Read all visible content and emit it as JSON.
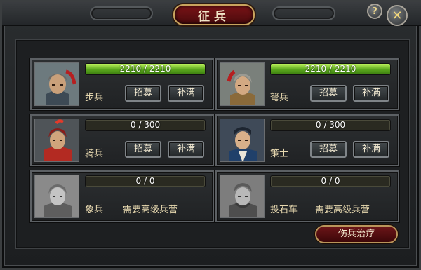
{
  "window": {
    "title": "征兵"
  },
  "header": {
    "help_label": "?",
    "close_label": "✕"
  },
  "units": [
    {
      "name": "步兵",
      "current": 2210,
      "max": 2210,
      "count_text": "2210 / 2210",
      "fill": 1.0,
      "recruit_label": "招募",
      "fill_label": "补满",
      "portrait": "infantry-general-portrait"
    },
    {
      "name": "弩兵",
      "current": 2210,
      "max": 2210,
      "count_text": "2210 / 2210",
      "fill": 1.0,
      "recruit_label": "招募",
      "fill_label": "补满",
      "portrait": "crossbow-general-portrait"
    },
    {
      "name": "骑兵",
      "current": 0,
      "max": 300,
      "count_text": "0 / 300",
      "fill": 0.0,
      "recruit_label": "招募",
      "fill_label": "补满",
      "portrait": "cavalry-general-portrait"
    },
    {
      "name": "策士",
      "current": 0,
      "max": 300,
      "count_text": "0 / 300",
      "fill": 0.0,
      "recruit_label": "招募",
      "fill_label": "补满",
      "portrait": "strategist-portrait"
    },
    {
      "name": "象兵",
      "current": 0,
      "max": 0,
      "count_text": "0 / 0",
      "fill": 0.0,
      "requirement": "需要高级兵营",
      "portrait": "elephant-soldier-portrait-locked"
    },
    {
      "name": "投石车",
      "current": 0,
      "max": 0,
      "count_text": "0 / 0",
      "fill": 0.0,
      "requirement": "需要高级兵营",
      "portrait": "catapult-general-portrait-locked"
    }
  ],
  "footer": {
    "heal_label": "伤兵治疗"
  },
  "colors": {
    "accent": "#7a1417",
    "gold": "#c8a45e",
    "bar_green": "#5aa71d",
    "text": "#e8d9b0"
  }
}
